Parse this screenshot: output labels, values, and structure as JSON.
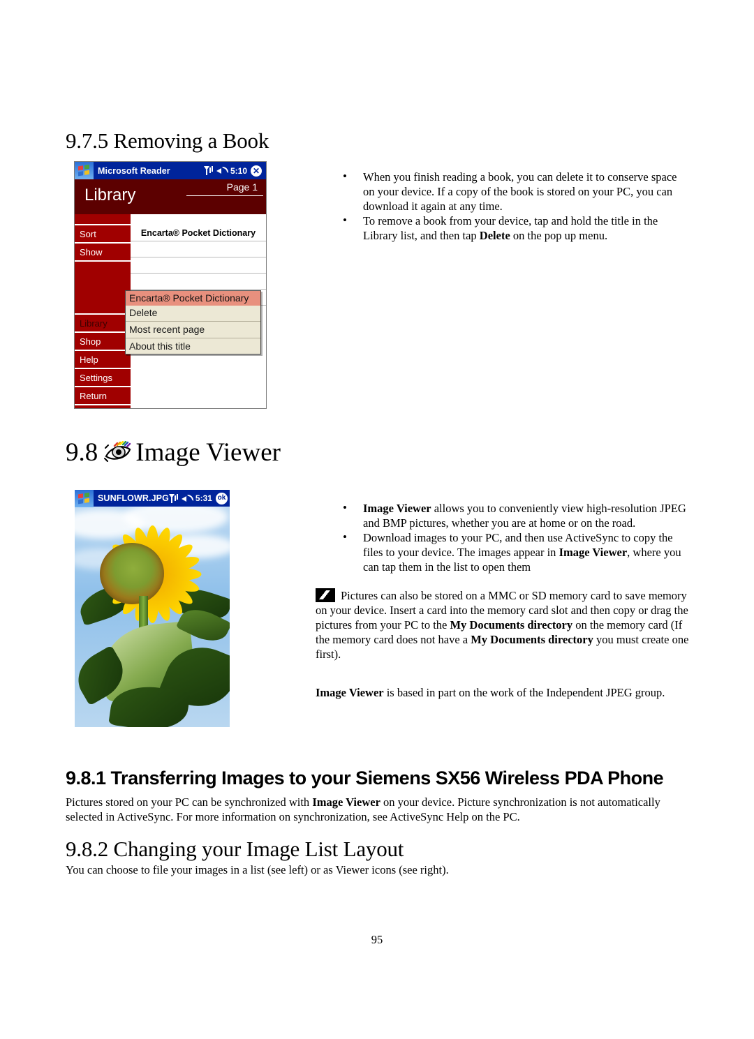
{
  "document": {
    "page_number": "95",
    "sections": {
      "removing_book": {
        "heading": "9.7.5 Removing a Book",
        "bullets": [
          "When you finish reading a book, you can delete it to conserve space on your device. If a copy of the book is stored on your PC, you can download it again at any time.",
          "To remove a book from your device, tap and hold the title in the Library list, and then tap Delete on the pop up menu."
        ]
      },
      "image_viewer": {
        "heading_number": "9.8",
        "heading_text": "Image Viewer",
        "icon": "eye-icon",
        "bullets": [
          "Image Viewer allows you to conveniently view high-resolution JPEG and BMP pictures, whether you are at home or on the road.",
          "Download images to your PC, and then use ActiveSync to copy the files to your device. The images appear in Image Viewer, where you can tap them in the list to open them"
        ],
        "note": "Pictures can also be stored on a MMC or SD memory card to save memory on your device. Insert a card into the memory card slot and then copy or drag the pictures from your PC to the My Documents directory on the memory card (If the memory card does not have a My Documents directory you must create one first).",
        "credit": "Image Viewer is based in part on the work of the Independent JPEG group."
      },
      "transferring": {
        "heading": "9.8.1 Transferring Images to your Siemens SX56 Wireless PDA Phone",
        "paragraph": "Pictures stored on your PC can be synchronized with Image Viewer on your device. Picture synchronization is not automatically selected in ActiveSync. For more information on synchronization, see ActiveSync Help on the PC."
      },
      "changing_layout": {
        "heading": "9.8.2 Changing your Image List Layout",
        "paragraph": "You can choose to file your images in a list (see left) or as Viewer icons (see right)."
      }
    }
  },
  "reader_screenshot": {
    "titlebar": {
      "app_title": "Microsoft Reader",
      "time": "5:10",
      "signal_icon": "signal-strength-icon",
      "speaker_icon": "speaker-icon",
      "close_icon": "close-icon",
      "close_label": "✕",
      "start_icon": "windows-start-icon"
    },
    "header": {
      "title": "Library",
      "page_label": "Page 1"
    },
    "sidebar_items": [
      {
        "label": "Sort",
        "selected": false
      },
      {
        "label": "Show",
        "selected": false
      },
      {
        "label": "Library",
        "selected": true
      },
      {
        "label": "Shop",
        "selected": false
      },
      {
        "label": "Help",
        "selected": false
      },
      {
        "label": "Settings",
        "selected": false
      },
      {
        "label": "Return",
        "selected": false
      }
    ],
    "book_list": [
      "Encarta® Pocket Dictionary"
    ],
    "popup_menu": {
      "items": [
        {
          "label": "Encarta® Pocket Dictionary",
          "highlight": true,
          "separator_after": false
        },
        {
          "label": "Delete",
          "highlight": false,
          "separator_after": true
        },
        {
          "label": "Most recent page",
          "highlight": false,
          "separator_after": true
        },
        {
          "label": "About this title",
          "highlight": false,
          "separator_after": false
        }
      ]
    },
    "colors": {
      "titlebar": "#00249B",
      "header": "#5C0000",
      "sidebar": "#A00000",
      "menu_background": "#ECE8D5",
      "menu_highlight": "#E8907E"
    }
  },
  "sunflower_screenshot": {
    "titlebar": {
      "file_name": "SUNFLOWR.JPG",
      "time": "5:31",
      "signal_icon": "signal-strength-icon",
      "speaker_icon": "speaker-icon",
      "ok_icon": "ok-button-icon",
      "ok_label": "ok",
      "start_icon": "windows-start-icon"
    },
    "image_subject": "sunflower-photograph"
  }
}
